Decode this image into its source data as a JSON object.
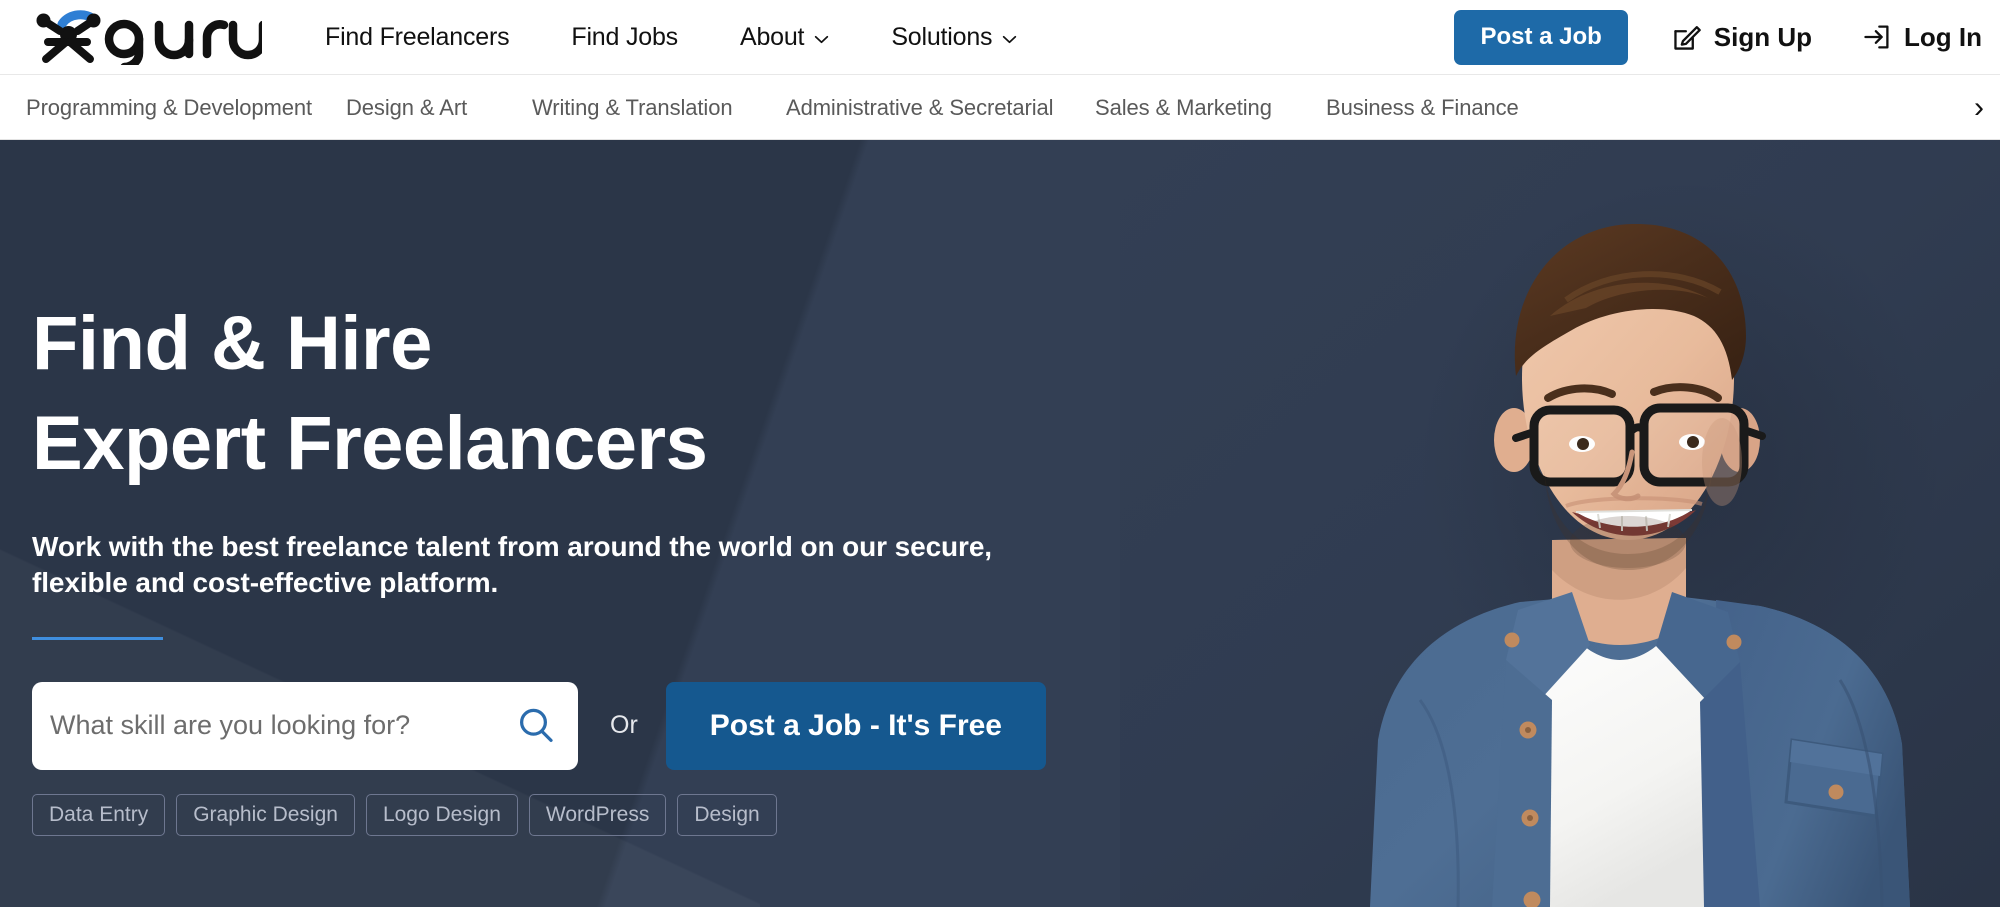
{
  "brand": {
    "name": "guru",
    "logo_icon": "guru-figure-logo",
    "accent_blue": "#2f7fd4",
    "logo_black": "#111111"
  },
  "colors": {
    "primary_button": "#1e6aa8",
    "hero_button": "#15588f",
    "hero_bg": "#333f54",
    "hero_bg_dark": "#2b3648",
    "rule_blue": "#3f8ede",
    "search_icon_blue": "#2b6cad",
    "tag_border": "#6e7790",
    "tag_text": "#b7bdcb",
    "category_text": "#5a5a5a"
  },
  "topnav": {
    "links": [
      {
        "label": "Find Freelancers",
        "has_dropdown": false
      },
      {
        "label": "Find Jobs",
        "has_dropdown": false
      },
      {
        "label": "About",
        "has_dropdown": true
      },
      {
        "label": "Solutions",
        "has_dropdown": true
      }
    ],
    "post_job_label": "Post a Job",
    "sign_up_label": "Sign Up",
    "sign_up_icon": "pencil-square-icon",
    "log_in_label": "Log In",
    "log_in_icon": "login-arrow-icon"
  },
  "categories": {
    "items": [
      "Programming & Development",
      "Design & Art",
      "Writing & Translation",
      "Administrative & Secretarial",
      "Sales & Marketing",
      "Business & Finance"
    ],
    "next_icon": "chevron-right-icon",
    "next_label": "›"
  },
  "hero": {
    "heading_line1": "Find & Hire",
    "heading_line2": "Expert Freelancers",
    "subheading": "Work with the best freelance talent from around the world on our secure, flexible and cost-effective platform.",
    "search_placeholder": "What skill are you looking for?",
    "search_value": "",
    "search_icon": "search-icon",
    "or_label": "Or",
    "post_job_free_label": "Post a Job - It's Free",
    "tags": [
      "Data Entry",
      "Graphic Design",
      "Logo Design",
      "WordPress",
      "Design"
    ],
    "photo_alt": "smiling man with glasses in denim shirt"
  }
}
